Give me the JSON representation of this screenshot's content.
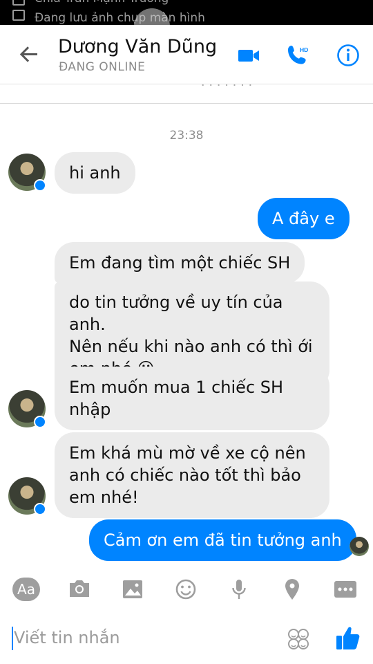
{
  "status_bar": {
    "line1": "Chia Trần Mạnh Trường",
    "line2": "Đang lưu ảnh chụp màn hình"
  },
  "header": {
    "contact_name": "Dương Văn Dũng",
    "status": "ĐANG ONLINE",
    "icons": [
      "back-arrow-icon",
      "video-call-icon",
      "hd-phone-icon",
      "info-icon"
    ],
    "accent": "#0084ff"
  },
  "conversation": {
    "timestamp": "23:38",
    "messages": [
      {
        "from": "contact",
        "text": "hi anh"
      },
      {
        "from": "me",
        "text": "A đây e"
      },
      {
        "from": "contact",
        "text": "Em đang tìm một chiếc SH"
      },
      {
        "from": "contact",
        "lines": [
          "do tin tưởng về uy tín của anh.",
          "Nên nếu khi nào anh có thì ới",
          "em nhé"
        ],
        "emoji": "😃"
      },
      {
        "from": "contact",
        "lines": [
          "Em muốn mua 1 chiếc SH",
          "nhập"
        ]
      },
      {
        "from": "contact",
        "lines": [
          "Em khá mù mờ về xe cộ nên",
          "anh có chiếc nào tốt thì bảo",
          "em nhé!"
        ]
      },
      {
        "from": "me",
        "text": "Cảm ơn em đã tin tưởng anh"
      }
    ]
  },
  "toolbar": {
    "text_style_label": "Aa",
    "icons": [
      "text-style-icon",
      "camera-icon",
      "gallery-icon",
      "emoji-icon",
      "microphone-icon",
      "location-icon",
      "more-icon"
    ]
  },
  "composer": {
    "placeholder": "Viết tin nhắn",
    "icons": [
      "stickers-icon",
      "like-icon"
    ]
  },
  "colors": {
    "incoming_bubble": "#ebebeb",
    "outgoing_bubble": "#0084ff",
    "icon_gray": "#9e9e9e"
  }
}
